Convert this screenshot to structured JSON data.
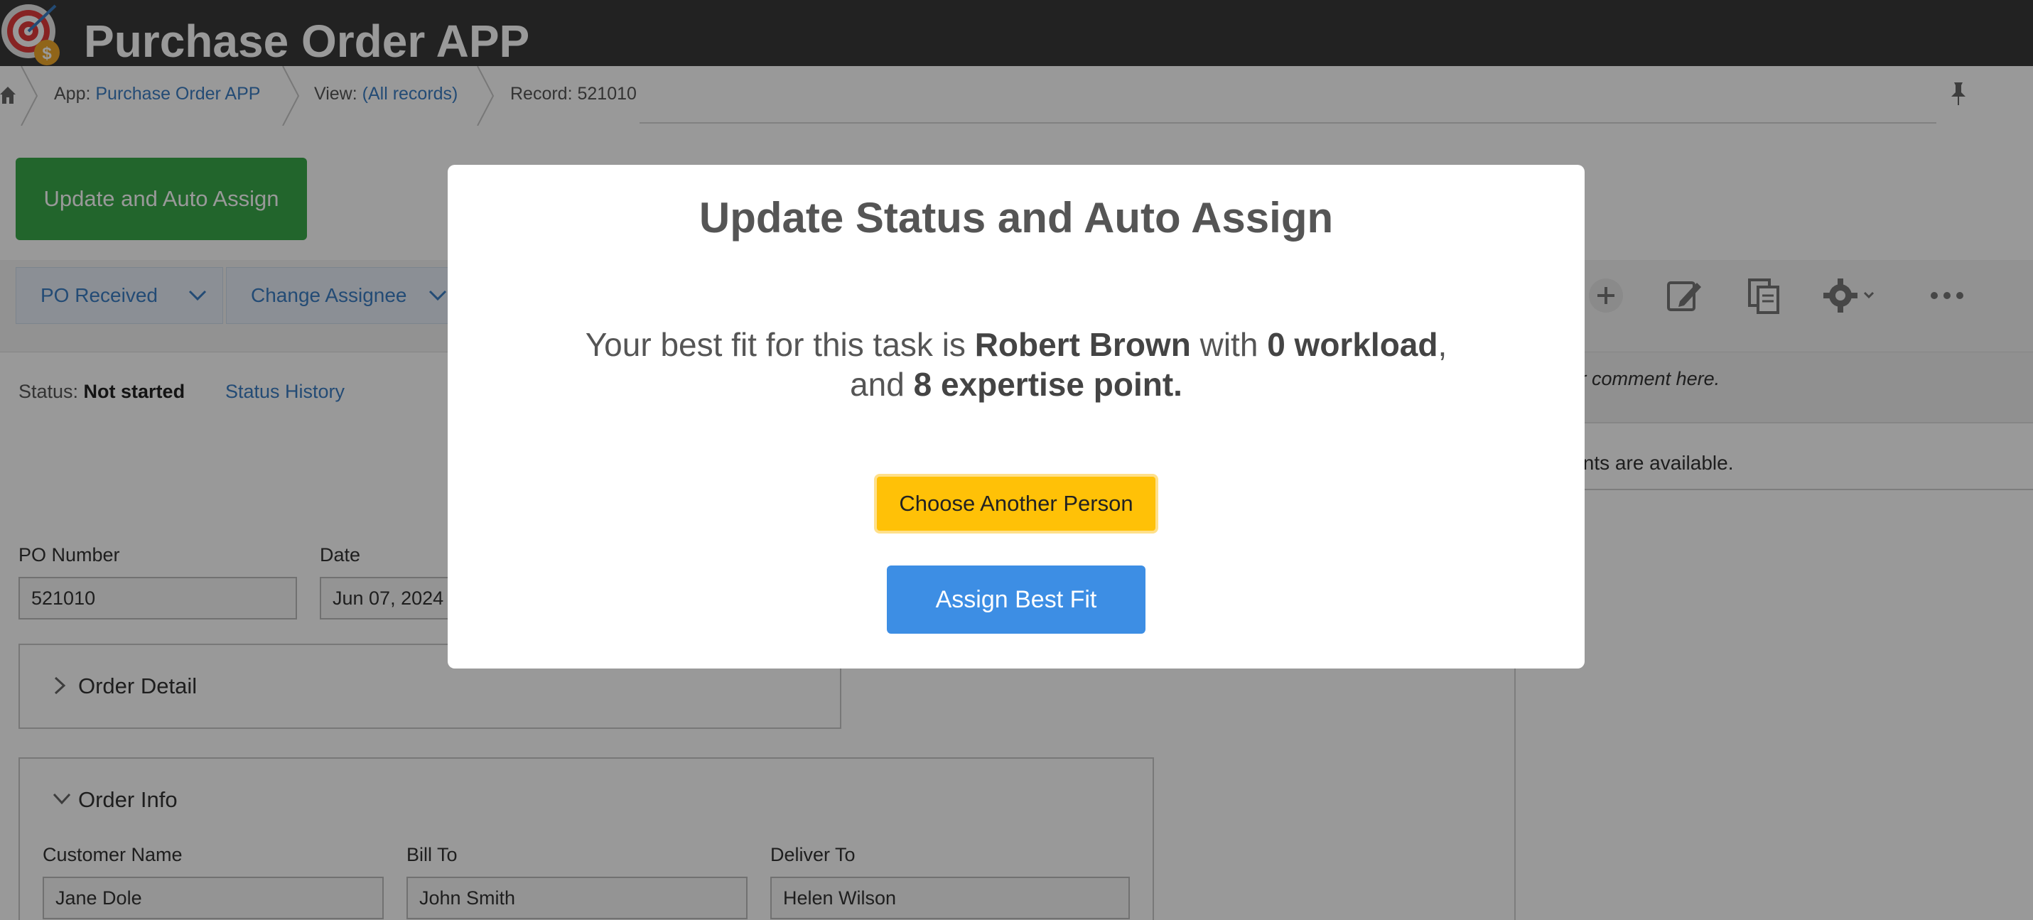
{
  "app": {
    "title": "Purchase Order APP"
  },
  "breadcrumb": {
    "app_prefix": "App: ",
    "app_link": "Purchase Order APP",
    "view_prefix": "View: ",
    "view_link": "(All records)",
    "record": "Record: 521010"
  },
  "actions": {
    "update_auto_assign": "Update and Auto Assign",
    "status_dropdown": "PO Received",
    "assignee_dropdown": "Change Assignee"
  },
  "toolbar": {
    "icons": [
      "plus-icon",
      "edit-icon",
      "duplicate-icon",
      "gear-icon",
      "more-icon"
    ]
  },
  "status": {
    "label": "Status: ",
    "value": "Not started",
    "history_link": "Status History"
  },
  "fields": {
    "po_number_label": "PO Number",
    "po_number_value": "521010",
    "date_label": "Date",
    "date_value": "Jun 07, 2024"
  },
  "sections": {
    "order_detail": "Order Detail",
    "order_info": "Order Info"
  },
  "order_info": {
    "customer_name_label": "Customer Name",
    "customer_name_value": "Jane Dole",
    "bill_to_label": "Bill To",
    "bill_to_value": "John Smith",
    "deliver_to_label": "Deliver To",
    "deliver_to_value": "Helen Wilson"
  },
  "comments": {
    "placeholder": "te your comment here.",
    "empty_message": "omments are available."
  },
  "modal": {
    "title": "Update Status and Auto Assign",
    "msg_prefix": "Your best fit for this task is ",
    "person": "Robert Brown",
    "msg_mid": " with ",
    "workload": "0 workload",
    "msg_comma": ",",
    "msg_and": "and ",
    "expertise": "8 expertise point.",
    "choose_button": "Choose Another Person",
    "assign_button": "Assign Best Fit"
  },
  "colors": {
    "header_bg": "#3a3a3a",
    "primary_green": "#3aa84a",
    "link_blue": "#3b7dc4",
    "choose_yellow": "#ffc107",
    "assign_blue": "#3d8ee4"
  }
}
